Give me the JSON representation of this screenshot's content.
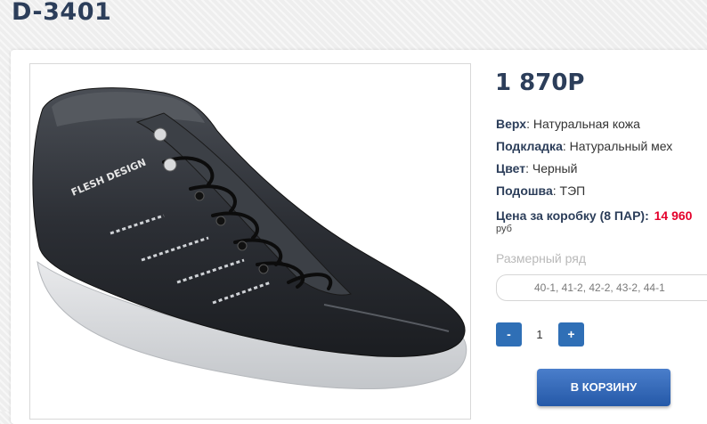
{
  "product": {
    "title": "D-3401",
    "price": "1 870Р",
    "image_alt": "FLESH DESIGN",
    "specs": [
      {
        "key": "Верх",
        "value": "Натуральная кожа"
      },
      {
        "key": "Подкладка",
        "value": "Натуральный мех"
      },
      {
        "key": "Цвет",
        "value": "Черный"
      },
      {
        "key": "Подошва",
        "value": "ТЭП"
      }
    ],
    "box_price_label": "Цена за коробку (8 ПАР):",
    "box_price_value": "14 960",
    "currency": "руб",
    "size_range_label": "Размерный ряд",
    "size_range_value": "40-1, 41-2, 42-2, 43-2, 44-1"
  },
  "quantity": {
    "minus": "-",
    "value": "1",
    "plus": "+"
  },
  "cart_button": "В КОРЗИНУ",
  "colors": {
    "title": "#2c3e5a",
    "accent": "#2f6fb6",
    "price_red": "#e4002b"
  }
}
